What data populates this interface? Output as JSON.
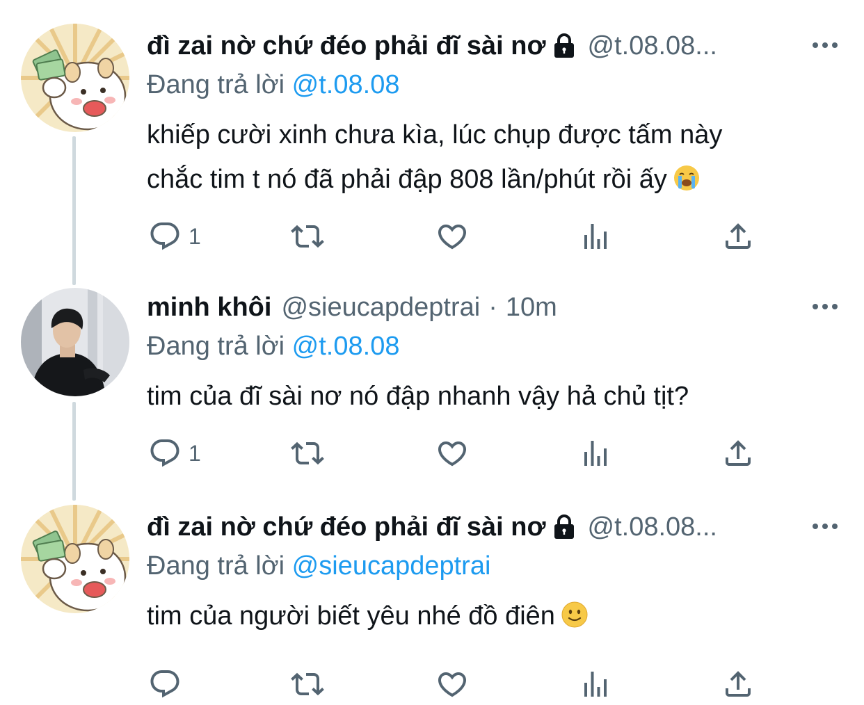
{
  "tweets": [
    {
      "display_name": "đì zai nờ chứ đéo phải đĩ sài nơ",
      "handle": "@t.08.08...",
      "time": "",
      "reply_prefix": "Đang trả lời",
      "reply_to": "@t.08.08",
      "text_lines": [
        "khiếp cười xinh chưa kìa, lúc chụp được tấm này",
        "chắc tim t nó đã phải đập 808 lần/phút rồi ấy"
      ],
      "emoji": "loudly-crying-face-emoji",
      "reply_count": "1",
      "avatar": "cat-holding-money-avatar"
    },
    {
      "display_name": "minh khôi",
      "handle": "@sieucapdeptrai",
      "separator": "·",
      "time": "10m",
      "reply_prefix": "Đang trả lời",
      "reply_to": "@t.08.08",
      "text_lines": [
        "tim của đĩ sài nơ nó đập nhanh vậy hả chủ tịt?"
      ],
      "emoji": "",
      "reply_count": "1",
      "avatar": "young-man-photo-avatar"
    },
    {
      "display_name": "đì zai nờ chứ đéo phải đĩ sài nơ",
      "handle": "@t.08.08...",
      "time": "",
      "reply_prefix": "Đang trả lời",
      "reply_to": "@sieucapdeptrai",
      "text_lines": [
        "tim của người biết yêu nhé đồ điên"
      ],
      "emoji": "slightly-smiling-face-emoji",
      "reply_count": "",
      "avatar": "cat-holding-money-avatar"
    }
  ],
  "icons": {
    "lock": "lock-icon",
    "more": "more-options-icon",
    "reply": "reply-icon",
    "retweet": "retweet-icon",
    "like": "like-icon",
    "views": "views-icon",
    "share": "share-icon"
  },
  "colors": {
    "link": "#1d9bf0",
    "secondary_text": "#536471",
    "primary_text": "#0f1419",
    "thread_line": "#cfd9de"
  }
}
